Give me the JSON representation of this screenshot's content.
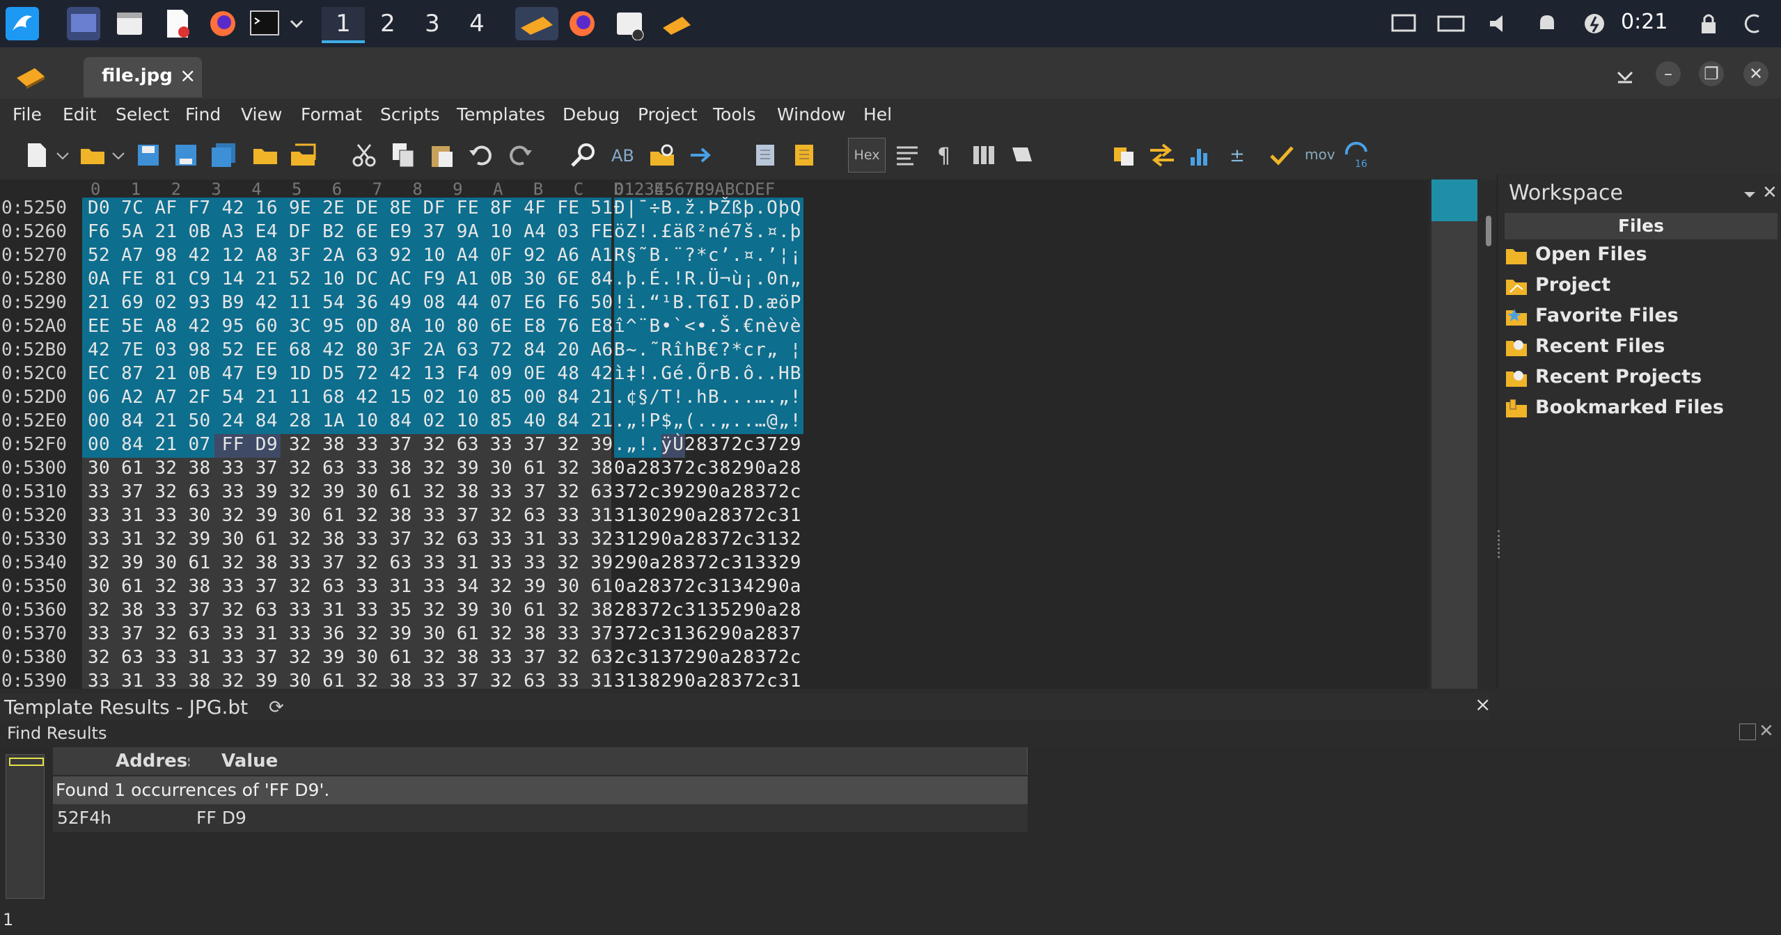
{
  "taskbar": {
    "desktops": [
      "1",
      "2",
      "3",
      "4"
    ],
    "clock": "0:21",
    "tray_icons": [
      "display-icon",
      "keyboard-icon",
      "volume-icon",
      "bell-icon",
      "power-icon",
      "lock-icon",
      "logout-icon"
    ]
  },
  "window": {
    "tab_label": "file.jpg",
    "tab_close": "×"
  },
  "menu": [
    "File",
    "Edit",
    "Select",
    "Find",
    "View",
    "Format",
    "Scripts",
    "Templates",
    "Debug",
    "Project",
    "Tools",
    "Window",
    "Hel"
  ],
  "toolbar": {
    "hex_label": "Hex",
    "mov_label": "mov"
  },
  "hex": {
    "col_header": "0   1   2   3   4   5   6   7   8   9   A   B   C   D   E   F",
    "ascii_header": "0123456789ABCDEF",
    "rows": [
      {
        "addr": "0:5250",
        "hex": "D0 7C AF F7 42 16 9E 2E DE 8E DF FE 8F 4F FE 51",
        "ascii": "Ð|¯÷B.ž.ÞŽßþ.OþQ"
      },
      {
        "addr": "0:5260",
        "hex": "F6 5A 21 0B A3 E4 DF B2 6E E9 37 9A 10 A4 03 FE",
        "ascii": "öZ!.£äß²né7š.¤.þ"
      },
      {
        "addr": "0:5270",
        "hex": "52 A7 98 42 12 A8 3F 2A 63 92 10 A4 0F 92 A6 A1",
        "ascii": "R§˜B.¨?*c’.¤.’¦¡"
      },
      {
        "addr": "0:5280",
        "hex": "0A FE 81 C9 14 21 52 10 DC AC F9 A1 0B 30 6E 84",
        "ascii": ".þ.É.!R.Ü¬ù¡.0n„"
      },
      {
        "addr": "0:5290",
        "hex": "21 69 02 93 B9 42 11 54 36 49 08 44 07 E6 F6 50",
        "ascii": "!i.“¹B.T6I.D.æöP"
      },
      {
        "addr": "0:52A0",
        "hex": "EE 5E A8 42 95 60 3C 95 0D 8A 10 80 6E E8 76 E8",
        "ascii": "î^¨B•`<•.Š.€nèvè"
      },
      {
        "addr": "0:52B0",
        "hex": "42 7E 03 98 52 EE 68 42 80 3F 2A 63 72 84 20 A6",
        "ascii": "B~.˜RîhB€?*cr„ ¦"
      },
      {
        "addr": "0:52C0",
        "hex": "EC 87 21 0B 47 E9 1D D5 72 42 13 F4 09 0E 48 42",
        "ascii": "ì‡!.Gé.ÕrB.ô..HB"
      },
      {
        "addr": "0:52D0",
        "hex": "06 A2 A7 2F 54 21 11 68 42 15 02 10 85 00 84 21",
        "ascii": ".¢§/T!.hB...….„!"
      },
      {
        "addr": "0:52E0",
        "hex": "00 84 21 50 24 84 28 1A 10 84 02 10 85 40 84 21",
        "ascii": ".„!P$„(..„..…@„!"
      },
      {
        "addr": "0:52F0",
        "hex": "00 84 21 07 FF D9 32 38 33 37 32 63 33 37 32 39",
        "ascii": ".„!.ÿÙ28372c3729"
      },
      {
        "addr": "0:5300",
        "hex": "30 61 32 38 33 37 32 63 33 38 32 39 30 61 32 38",
        "ascii": "0a28372c38290a28"
      },
      {
        "addr": "0:5310",
        "hex": "33 37 32 63 33 39 32 39 30 61 32 38 33 37 32 63",
        "ascii": "372c39290a28372c"
      },
      {
        "addr": "0:5320",
        "hex": "33 31 33 30 32 39 30 61 32 38 33 37 32 63 33 31",
        "ascii": "3130290a28372c31"
      },
      {
        "addr": "0:5330",
        "hex": "33 31 32 39 30 61 32 38 33 37 32 63 33 31 33 32",
        "ascii": "31290a28372c3132"
      },
      {
        "addr": "0:5340",
        "hex": "32 39 30 61 32 38 33 37 32 63 33 31 33 33 32 39",
        "ascii": "290a28372c313329"
      },
      {
        "addr": "0:5350",
        "hex": "30 61 32 38 33 37 32 63 33 31 33 34 32 39 30 61",
        "ascii": "0a28372c3134290a"
      },
      {
        "addr": "0:5360",
        "hex": "32 38 33 37 32 63 33 31 33 35 32 39 30 61 32 38",
        "ascii": "28372c3135290a28"
      },
      {
        "addr": "0:5370",
        "hex": "33 37 32 63 33 31 33 36 32 39 30 61 32 38 33 37",
        "ascii": "372c3136290a2837"
      },
      {
        "addr": "0:5380",
        "hex": "32 63 33 31 33 37 32 39 30 61 32 38 33 37 32 63",
        "ascii": "2c3137290a28372c"
      },
      {
        "addr": "0:5390",
        "hex": "33 31 33 38 32 39 30 61 32 38 33 37 32 63 33 31",
        "ascii": "3138290a28372c31"
      }
    ]
  },
  "workspace": {
    "title": "Workspace",
    "section": "Files",
    "items": [
      "Open Files",
      "Project",
      "Favorite Files",
      "Recent Files",
      "Recent Projects",
      "Bookmarked Files"
    ]
  },
  "template_results": {
    "title": "Template Results - JPG.bt",
    "close": "×"
  },
  "find_results": {
    "title": "Find Results",
    "columns": [
      "Address",
      "Value"
    ],
    "summary": "Found 1 occurrences of 'FF D9'.",
    "rows": [
      {
        "address": "52F4h",
        "value": "FF D9"
      }
    ],
    "footer_count": "1"
  }
}
